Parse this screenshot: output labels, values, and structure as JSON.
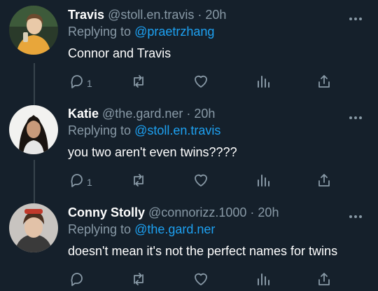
{
  "tweets": [
    {
      "name": "Travis",
      "handle": "@stoll.en.travis",
      "time": "20h",
      "replying_prefix": "Replying to",
      "replying_to": "@praetrzhang",
      "text": "Connor and Travis",
      "reply_count": "1",
      "avatar_colors": {
        "bg": "#2a3a2a",
        "shirt": "#e8a63a",
        "face": "#e9c9a8",
        "hair": "#6b4a2e"
      }
    },
    {
      "name": "Katie",
      "handle": "@the.gard.ner",
      "time": "20h",
      "replying_prefix": "Replying to",
      "replying_to": "@stoll.en.travis",
      "text": "you two aren't even twins????",
      "reply_count": "1",
      "avatar_colors": {
        "bg": "#f2f2f0",
        "shirt": "#e6e6e6",
        "face": "#c89a7a",
        "hair": "#1a1410"
      }
    },
    {
      "name": "Conny Stolly",
      "handle": "@connorizz.1000",
      "time": "20h",
      "replying_prefix": "Replying to",
      "replying_to": "@the.gard.ner",
      "text": "doesn't mean it's not the perfect names for twins",
      "reply_count": "",
      "avatar_colors": {
        "bg": "#c8c4c0",
        "shirt": "#3a3a3a",
        "face": "#e2c2a8",
        "hair": "#4a3020"
      }
    }
  ],
  "ui": {
    "more_icon": "more-horizontal-icon",
    "dot": "·",
    "colors": {
      "background": "#15202b",
      "secondary_text": "#8899a6",
      "link": "#1da1f2",
      "thread_line": "#38444d"
    }
  }
}
